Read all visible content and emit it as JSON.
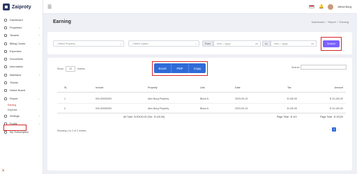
{
  "brand": {
    "name": "Zaiproty"
  },
  "sidebar": {
    "items": [
      {
        "label": "Dashboard"
      },
      {
        "label": "Properties",
        "chevron": "›"
      },
      {
        "label": "Tenants",
        "chevron": "›"
      },
      {
        "label": "Billing Center",
        "chevron": "›"
      },
      {
        "label": "Expenses"
      },
      {
        "label": "Documents"
      },
      {
        "label": "Information"
      },
      {
        "label": "Maintains",
        "chevron": "›"
      },
      {
        "label": "Tickets"
      },
      {
        "label": "Notice Board"
      },
      {
        "label": "Report",
        "chevron": "⌄"
      }
    ],
    "report_sub": [
      {
        "label": "Earning",
        "active": true
      },
      {
        "label": "Expense"
      }
    ],
    "items_after": [
      {
        "label": "Settings",
        "chevron": "›"
      },
      {
        "label": "Profile",
        "chevron": "›"
      },
      {
        "label": "My Subscription"
      }
    ]
  },
  "topbar": {
    "user_name": "Alexa Burg"
  },
  "page": {
    "title": "Earning"
  },
  "breadcrumb": [
    "Dashboard",
    "/",
    "Report",
    "/",
    "Earning"
  ],
  "filters": {
    "property_placeholder": "--Select Property--",
    "option_placeholder": "--Select Option--",
    "from_label": "From",
    "to_label": "to",
    "date_placeholder": "mm/----/yyyy",
    "search_button": "Search"
  },
  "export": {
    "excel": "Excel",
    "pdf": "PDF",
    "copy": "Copy"
  },
  "table_controls": {
    "show_label": "Show",
    "page_len": "10",
    "entries_label": "entries",
    "search_label": "Search:"
  },
  "table": {
    "columns": [
      "SL",
      "Invoice",
      "Property",
      "Unit",
      "Date",
      "Tax",
      "Amount"
    ],
    "rows": [
      [
        "1",
        "INV-00000000",
        "Alex Burg Property",
        "Block A",
        "2023-09-19",
        "$ 100.00",
        "$ 10,100.00"
      ],
      [
        "2",
        "INV-00000000",
        "Alex Burg Property",
        "Block A",
        "2023-09-19",
        "$ 100.00",
        "$ 10,100.00"
      ]
    ],
    "totals": {
      "all_total": "All Total : $ 90120.00 (Tax : $ 110.00)",
      "page_total_tax": "Page Total : $ 110",
      "page_total_amount": "Page Total : $ 10120"
    }
  },
  "footer": {
    "showing": "Showing 1 to 2 of 2 entries",
    "prev": "‹",
    "page": "1",
    "next": "›"
  }
}
